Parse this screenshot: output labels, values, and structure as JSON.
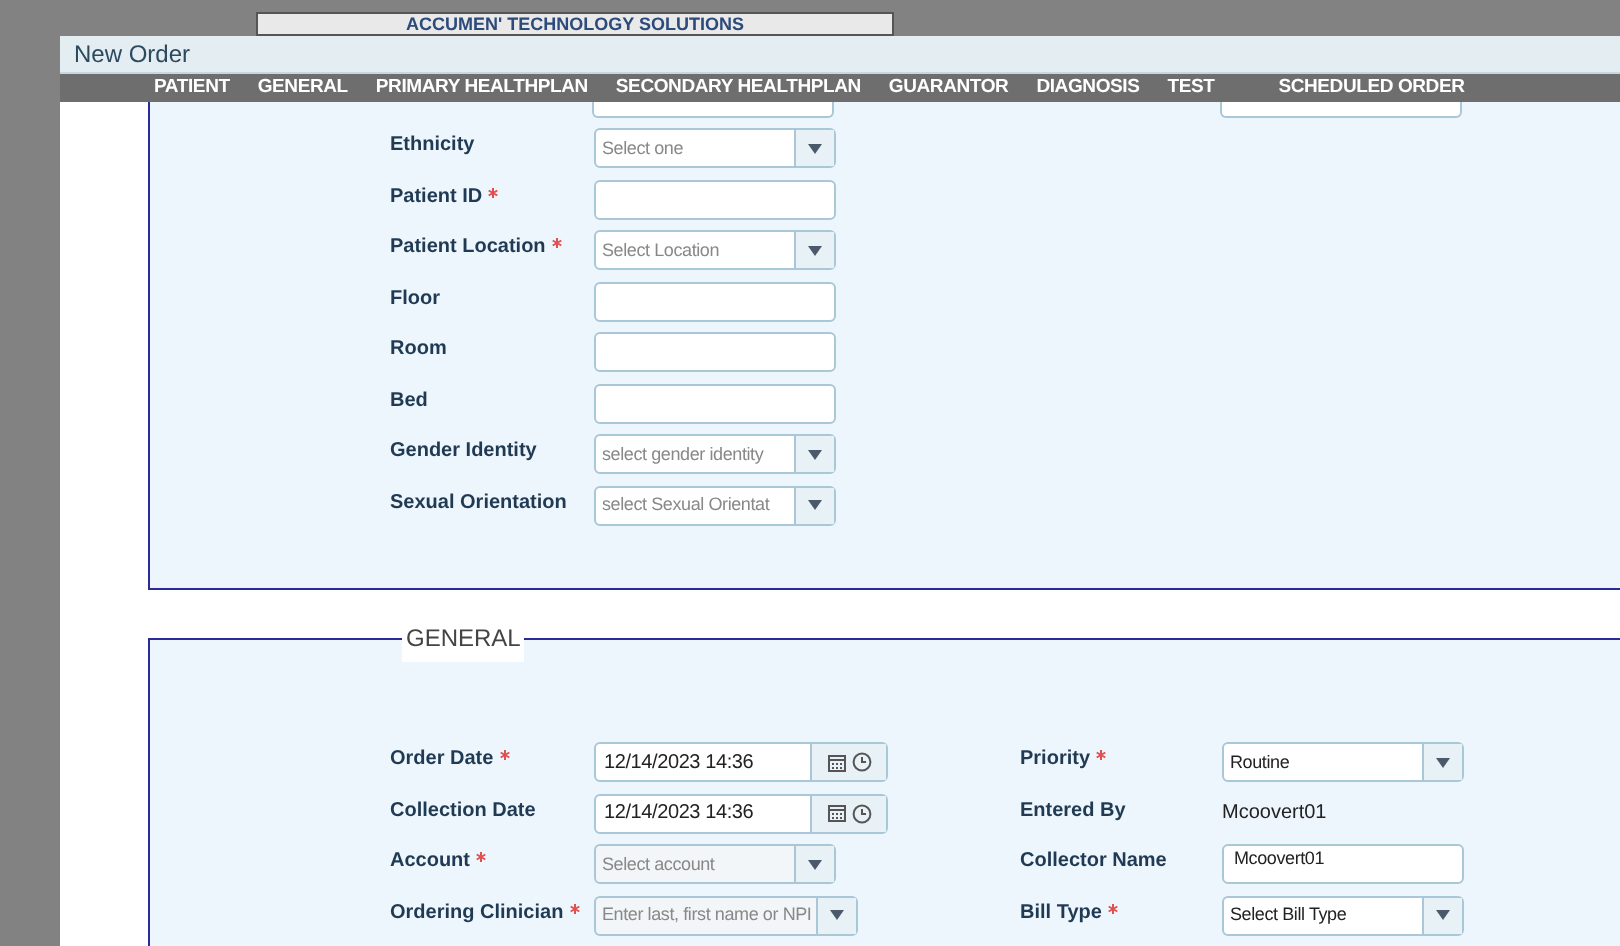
{
  "banner": {
    "title": "ACCUMEN' TECHNOLOGY SOLUTIONS"
  },
  "window": {
    "title": "New Order"
  },
  "tabs": [
    {
      "label": "PATIENT"
    },
    {
      "label": "GENERAL"
    },
    {
      "label": "PRIMARY HEALTHPLAN"
    },
    {
      "label": "SECONDARY HEALTHPLAN"
    },
    {
      "label": "GUARANTOR"
    },
    {
      "label": "DIAGNOSIS"
    },
    {
      "label": "TEST"
    },
    {
      "label": "SCHEDULED ORDER"
    }
  ],
  "patient_section": {
    "fields": [
      {
        "label": "Ethnicity",
        "required": false,
        "kind": "select",
        "placeholder": "Select one"
      },
      {
        "label": "Patient ID",
        "required": true,
        "kind": "input"
      },
      {
        "label": "Patient Location",
        "required": true,
        "kind": "select",
        "placeholder": "Select Location"
      },
      {
        "label": "Floor",
        "required": false,
        "kind": "input"
      },
      {
        "label": "Room",
        "required": false,
        "kind": "input"
      },
      {
        "label": "Bed",
        "required": false,
        "kind": "input"
      },
      {
        "label": "Gender Identity",
        "required": false,
        "kind": "select",
        "placeholder": "select gender identity"
      },
      {
        "label": "Sexual Orientation",
        "required": false,
        "kind": "select",
        "placeholder": "select Sexual Orientat"
      }
    ]
  },
  "general_section": {
    "title": "GENERAL",
    "left_fields": [
      {
        "label": "Order Date",
        "required": true,
        "kind": "datetime",
        "value": "12/14/2023 14:36"
      },
      {
        "label": "Collection Date",
        "required": false,
        "kind": "datetime",
        "value": "12/14/2023 14:36"
      },
      {
        "label": "Account",
        "required": true,
        "kind": "select",
        "placeholder": "Select account",
        "disabled": true
      },
      {
        "label": "Ordering Clinician",
        "required": true,
        "kind": "select",
        "placeholder": "Enter last, first name or NPI",
        "disabled": true
      }
    ],
    "right_fields": [
      {
        "label": "Priority",
        "required": true,
        "kind": "select",
        "value": "Routine"
      },
      {
        "label": "Entered By",
        "required": false,
        "kind": "text",
        "value": "Mcoovert01"
      },
      {
        "label": "Collector Name",
        "required": false,
        "kind": "input",
        "value": "Mcoovert01"
      },
      {
        "label": "Bill Type",
        "required": true,
        "kind": "select",
        "value": "Select Bill Type"
      }
    ]
  }
}
